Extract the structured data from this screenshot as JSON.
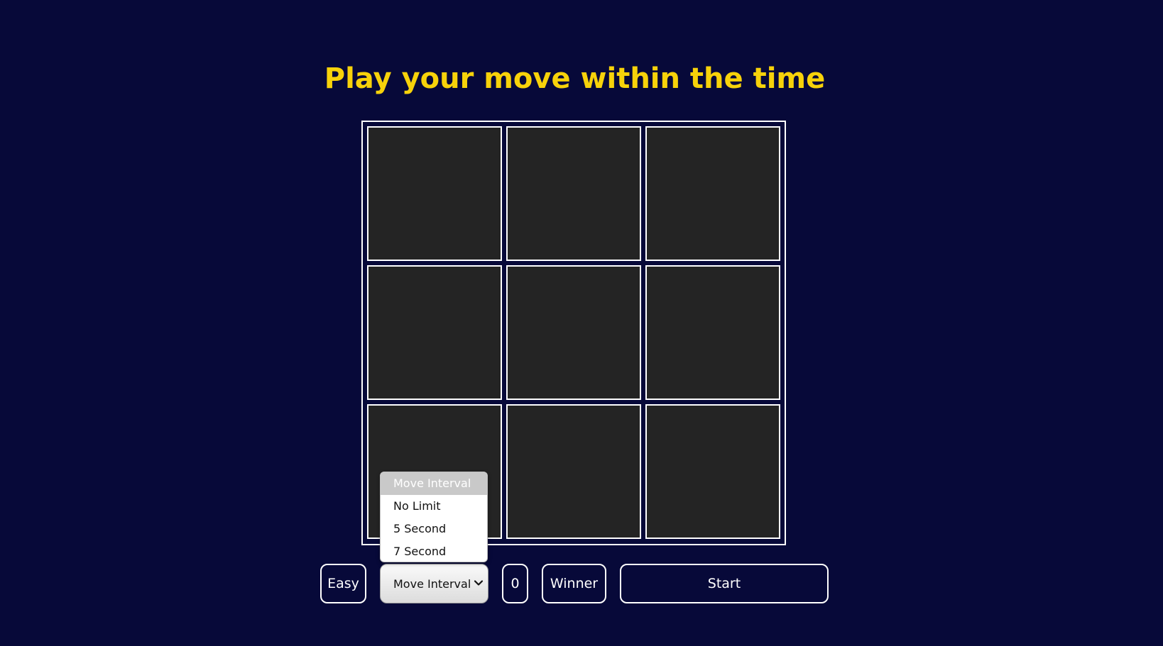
{
  "title": "Play your move within the time",
  "board": {
    "cells": [
      "",
      "",
      "",
      "",
      "",
      "",
      "",
      "",
      ""
    ]
  },
  "controls": {
    "difficulty_label": "Easy",
    "interval_select": {
      "selected": "Move Interval",
      "options": [
        "Move Interval",
        "No Limit",
        "5 Second",
        "7 Second"
      ]
    },
    "score": "0",
    "winner_label": "Winner",
    "start_label": "Start"
  },
  "colors": {
    "background": "#070939",
    "title": "#f7d20a",
    "cell": "#242424",
    "border": "#ffffff"
  }
}
